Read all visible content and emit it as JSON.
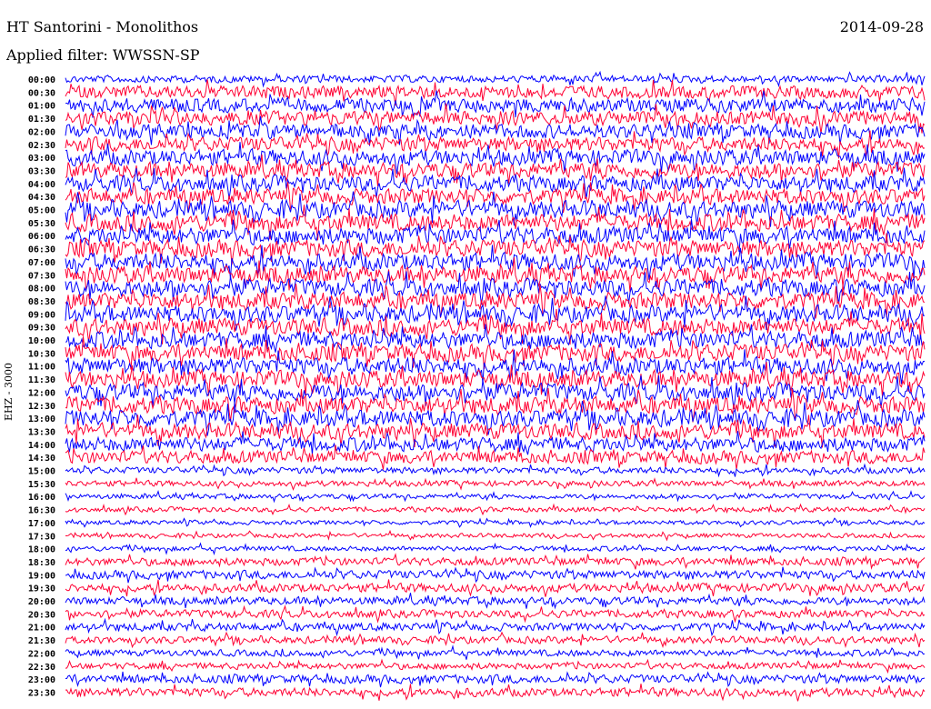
{
  "header": {
    "station": "HT Santorini - Monolithos",
    "date": "2014-09-28",
    "filter": "Applied filter: WWSSN-SP"
  },
  "chart_data": {
    "type": "line",
    "title": "HT Santorini - Monolithos",
    "ylabel": "EHZ - 3000",
    "trace_colors": [
      "#0000ff",
      "#ff0033"
    ],
    "rows": [
      "00:00",
      "00:30",
      "01:00",
      "01:30",
      "02:00",
      "02:30",
      "03:00",
      "03:30",
      "04:00",
      "04:30",
      "05:00",
      "05:30",
      "06:00",
      "06:30",
      "07:00",
      "07:30",
      "08:00",
      "08:30",
      "09:00",
      "09:30",
      "10:00",
      "10:30",
      "11:00",
      "11:30",
      "12:00",
      "12:30",
      "13:00",
      "13:30",
      "14:00",
      "14:30",
      "15:00",
      "15:30",
      "16:00",
      "16:30",
      "17:00",
      "17:30",
      "18:00",
      "18:30",
      "19:00",
      "19:30",
      "20:00",
      "20:30",
      "21:00",
      "21:30",
      "22:00",
      "22:30",
      "23:00",
      "23:30"
    ],
    "amplitude_level": [
      0.5,
      0.9,
      1.0,
      1.0,
      1.0,
      1.0,
      1.1,
      1.1,
      1.1,
      1.1,
      1.2,
      1.2,
      1.2,
      1.2,
      1.2,
      1.2,
      1.2,
      1.2,
      1.2,
      1.2,
      1.2,
      1.2,
      1.2,
      1.2,
      1.2,
      1.2,
      1.2,
      1.1,
      1.0,
      0.9,
      0.45,
      0.4,
      0.35,
      0.35,
      0.3,
      0.3,
      0.35,
      0.55,
      0.6,
      0.6,
      0.55,
      0.55,
      0.55,
      0.5,
      0.45,
      0.45,
      0.6,
      0.6
    ]
  }
}
